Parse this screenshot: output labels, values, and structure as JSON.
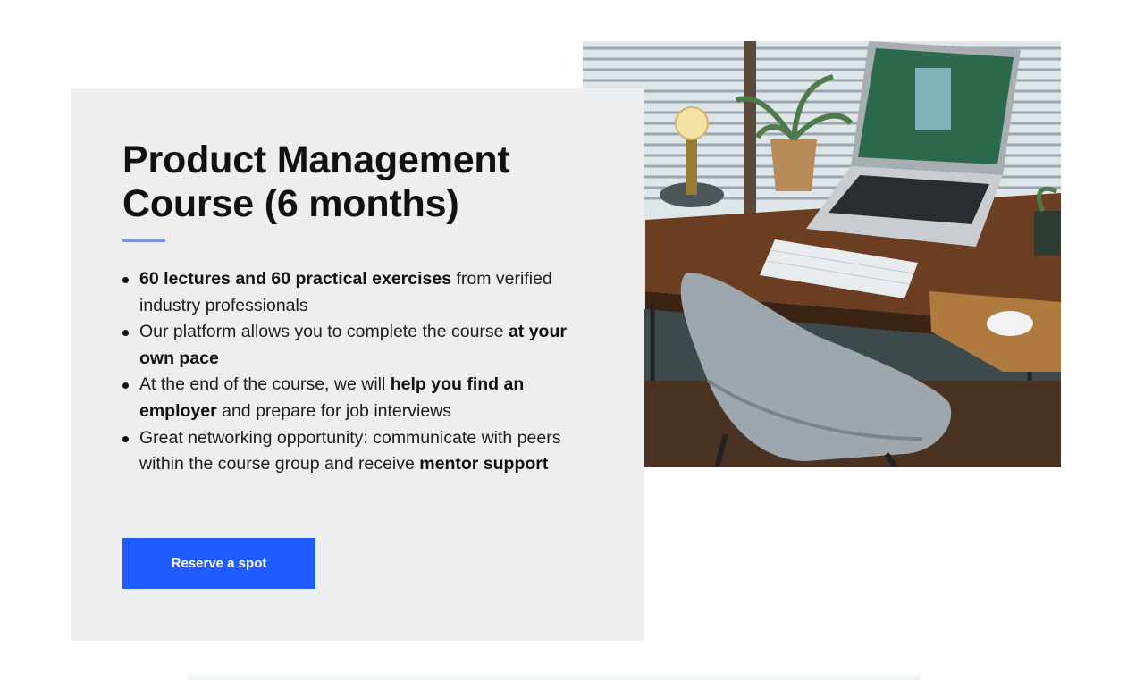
{
  "course": {
    "title_line_1": "Product Management",
    "title_line_2": "Course (6 months)",
    "features": [
      {
        "bold_1": "60 lectures and 60 practical exercises",
        "text_1": " from verified industry professionals"
      },
      {
        "text_1": "Our platform allows you to complete the course ",
        "bold_1": "at your own pace"
      },
      {
        "text_1": "At the end of the course, we will ",
        "bold_1": "help you find an employer",
        "text_2": " and prepare for job interviews"
      },
      {
        "text_1": "Great networking opportunity: communicate with peers within the course group and receive ",
        "bold_1": "mentor support"
      }
    ],
    "cta_label": "Reserve a spot"
  },
  "photo": {
    "icon": "workspace-desk-photo"
  },
  "colors": {
    "accent": "#1f5bff",
    "divider": "#7b8fe6",
    "card_background": "#eceef0",
    "heading": "#111111"
  }
}
